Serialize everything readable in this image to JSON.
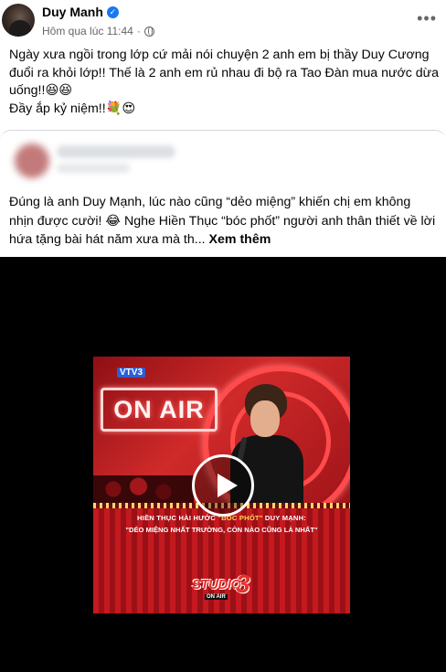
{
  "post": {
    "author": "Duy Manh",
    "timestamp": "Hôm qua lúc 11:44",
    "dot": "·",
    "more": "•••",
    "line1": "Ngày xưa ngồi trong lớp cứ mải nói chuyện 2 anh em bị thầy Duy Cương đuổi ra khỏi lớp!! Thế là 2 anh em rủ nhau đi bộ ra Tao Đàn mua nước dừa uống!!😆😆",
    "line2": "Đầy ắp kỷ niệm!!💐😍"
  },
  "shared": {
    "text": "Đúng là anh Duy Mạnh, lúc nào cũng “dẻo miệng” khiến chị em không nhịn được cười! 😂 Nghe Hiền Thục “bóc phốt” người anh thân thiết về lời hứa tặng bài hát năm xưa mà th...",
    "see_more": "Xem thêm"
  },
  "video": {
    "vtv": "VTV3",
    "on_air": "ON AIR",
    "caption_prefix": "HIỀN THỤC HÀI HƯỚC ",
    "caption_highlight": "\"BÓC PHỐT\"",
    "caption_suffix": " DUY MẠNH:",
    "caption2": "\"DẺO MIỆNG NHẤT TRƯỜNG, CÒN NÀO CŨNG LÀ NHẤT\"",
    "logo_word": "STUDIO",
    "logo_sub": "ON AIR",
    "logo_num": "3"
  },
  "colors": {
    "verified": "#1877f2",
    "meta": "#65676b",
    "curtain": "#c4191f"
  }
}
